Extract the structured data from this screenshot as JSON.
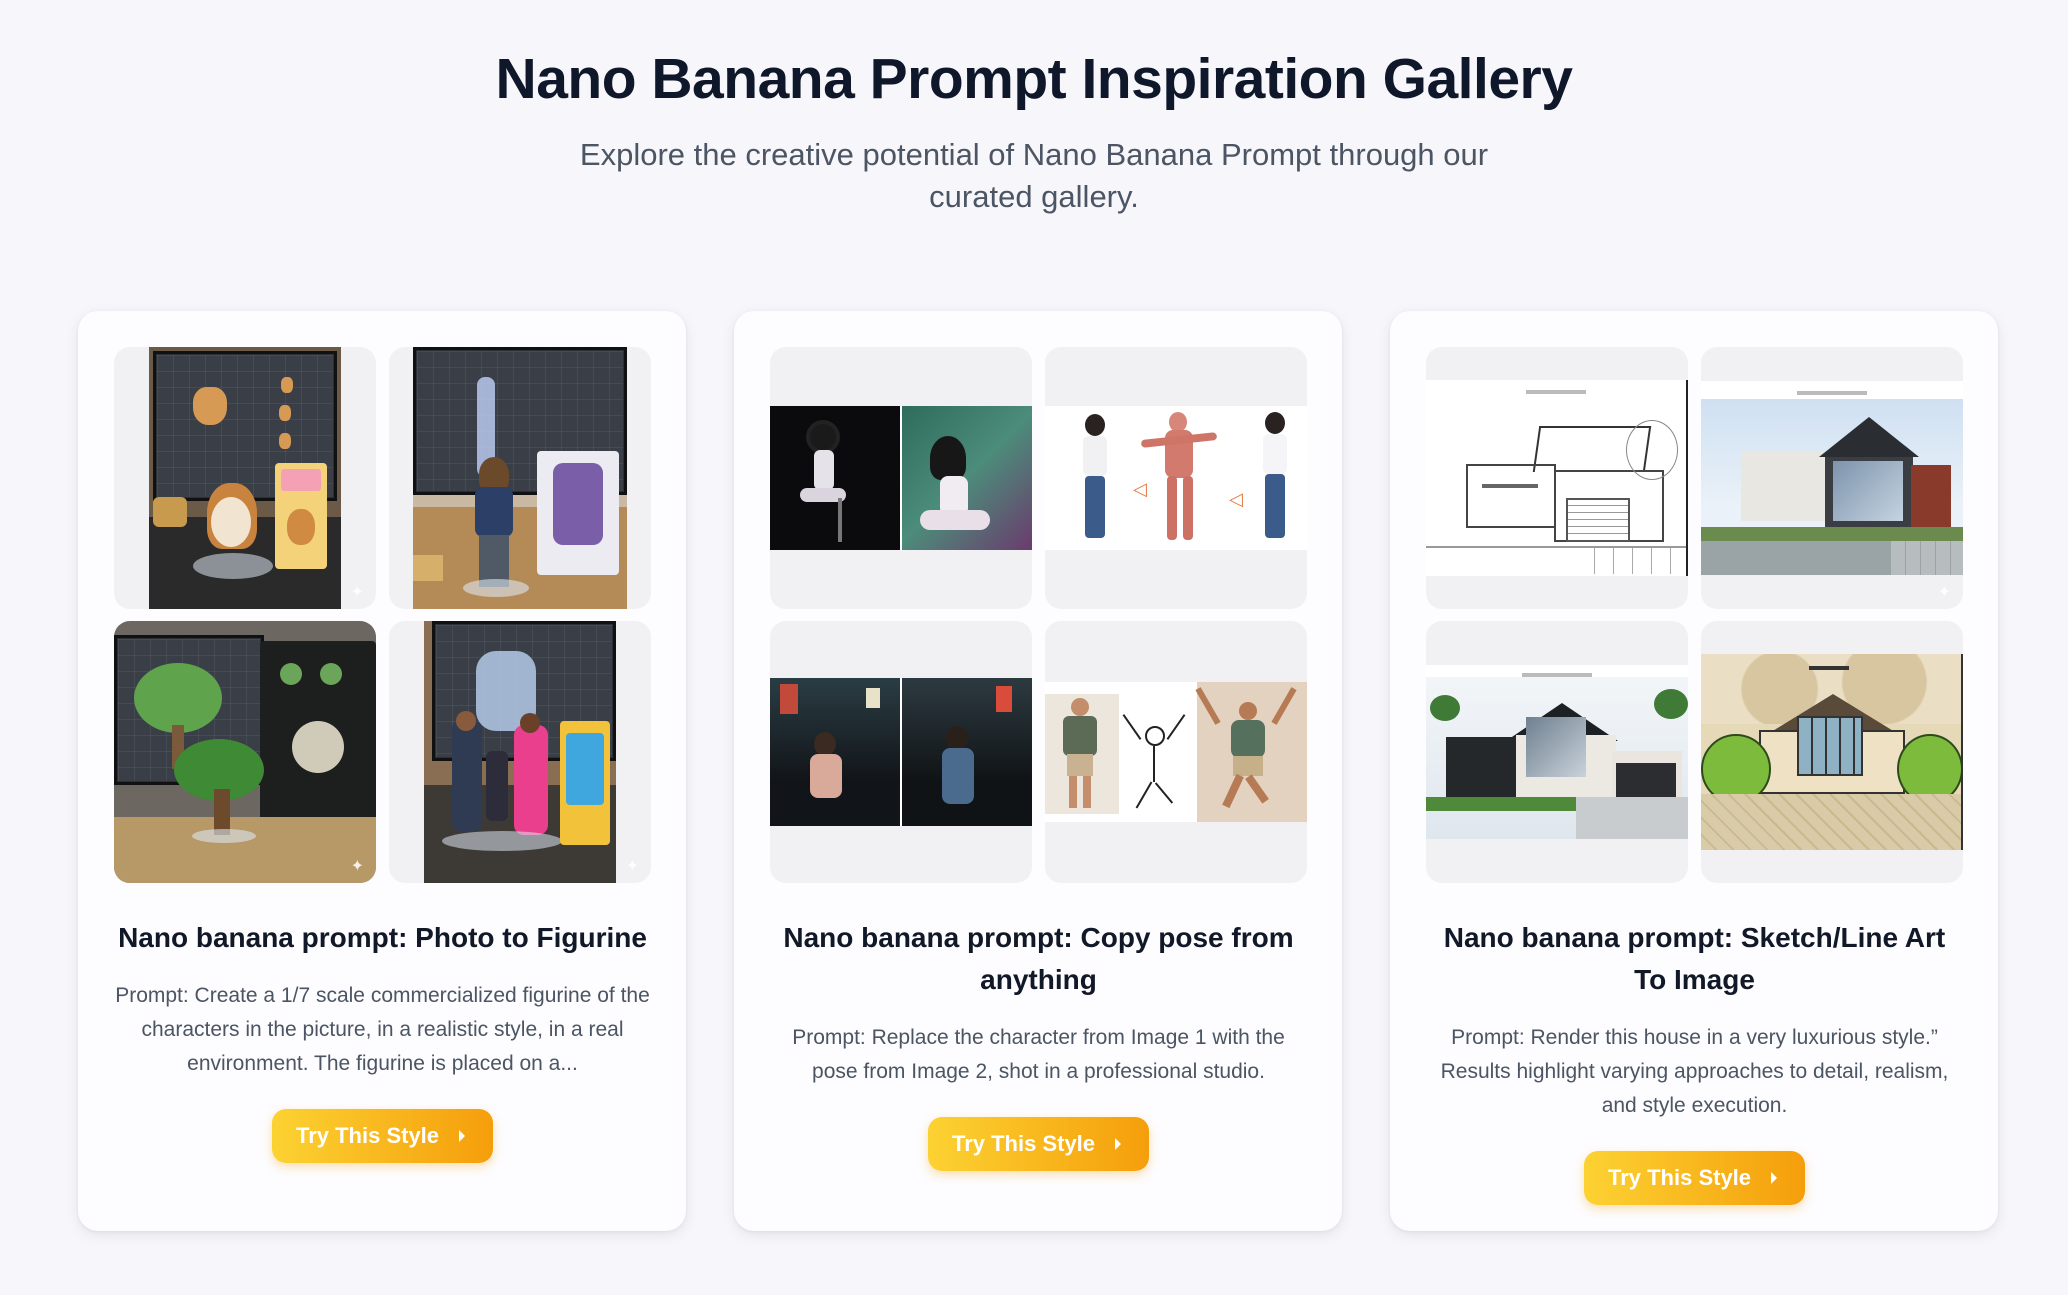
{
  "header": {
    "title": "Nano Banana Prompt Inspiration Gallery",
    "subtitle": "Explore the creative potential of Nano Banana Prompt through our curated gallery."
  },
  "cards": [
    {
      "title": "Nano banana prompt: Photo to Figurine",
      "description": "Prompt: Create a 1/7 scale commercialized figurine of the characters in the picture, in a realistic style, in a real environment. The figurine is placed on a...",
      "button_label": "Try This Style"
    },
    {
      "title": "Nano banana prompt: Copy pose from anything",
      "description": "Prompt: Replace the character from Image 1 with the pose from Image 2, shot in a professional studio.",
      "button_label": "Try This Style"
    },
    {
      "title": "Nano banana prompt: Sketch/Line Art To Image",
      "description": "Prompt: Render this house in a very luxurious style.” Results highlight varying approaches to detail, realism, and style execution.",
      "button_label": "Try This Style"
    }
  ],
  "colors": {
    "background": "#f7f6fa",
    "card": "#fdfcfe",
    "button_start": "#fcd232",
    "button_end": "#f59e0b",
    "title": "#0f172a",
    "body_text": "#4b5563"
  },
  "icons": {
    "button_icon": "chevron-right-icon",
    "image_badge": "sparkle-icon"
  }
}
